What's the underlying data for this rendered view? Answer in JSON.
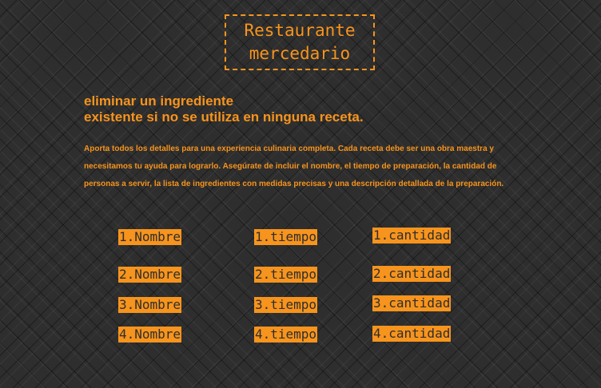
{
  "header": {
    "logo_text": "Restaurante\nmercedario"
  },
  "main": {
    "heading": "eliminar un ingrediente\nexistente si no se utiliza en ninguna receta.",
    "intro": "Aporta todos los detalles para una experiencia culinaria completa. Cada receta debe ser una obra maestra y necesitamos tu ayuda para lograrlo. Asegúrate de incluir el nombre, el tiempo de preparación, la cantidad de personas a servir, la lista de ingredientes con medidas precisas y una descripción detallada de la preparación."
  },
  "rows": [
    {
      "nombre": "1.Nombre",
      "tiempo": "1.tiempo",
      "cantidad": "1.cantidad"
    },
    {
      "nombre": "2.Nombre",
      "tiempo": "2.tiempo",
      "cantidad": "2.cantidad"
    },
    {
      "nombre": "3.Nombre",
      "tiempo": "3.tiempo",
      "cantidad": "3.cantidad"
    },
    {
      "nombre": "4.Nombre",
      "tiempo": "4.tiempo",
      "cantidad": "4.cantidad"
    }
  ],
  "colors": {
    "accent": "#f7941d",
    "background": "#2e2e2e"
  }
}
